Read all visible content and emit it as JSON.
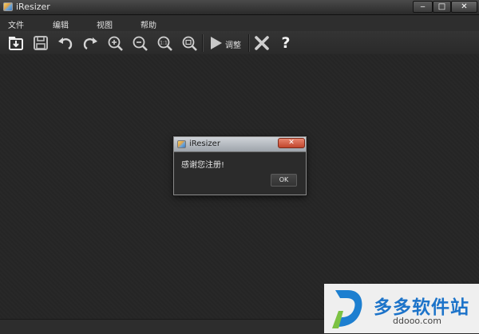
{
  "window": {
    "title": "iResizer",
    "controls": {
      "minimize": "‒",
      "maximize": "□",
      "close": "✕"
    }
  },
  "menu": {
    "items": [
      "文件",
      "编辑",
      "视图",
      "帮助"
    ]
  },
  "toolbar": {
    "adjust_label": "调整",
    "help_glyph": "?",
    "icons": [
      "open-icon",
      "save-icon",
      "undo-icon",
      "redo-icon",
      "zoom-in-icon",
      "zoom-out-icon",
      "actual-size-icon",
      "fit-to-window-icon",
      "play-icon",
      "delete-icon",
      "help-icon"
    ]
  },
  "dialog": {
    "title": "iResizer",
    "message": "感谢您注册!",
    "ok_label": "OK",
    "close_glyph": "✕"
  },
  "watermark": {
    "main": "多多软件站",
    "sub": "ddooo.com"
  }
}
